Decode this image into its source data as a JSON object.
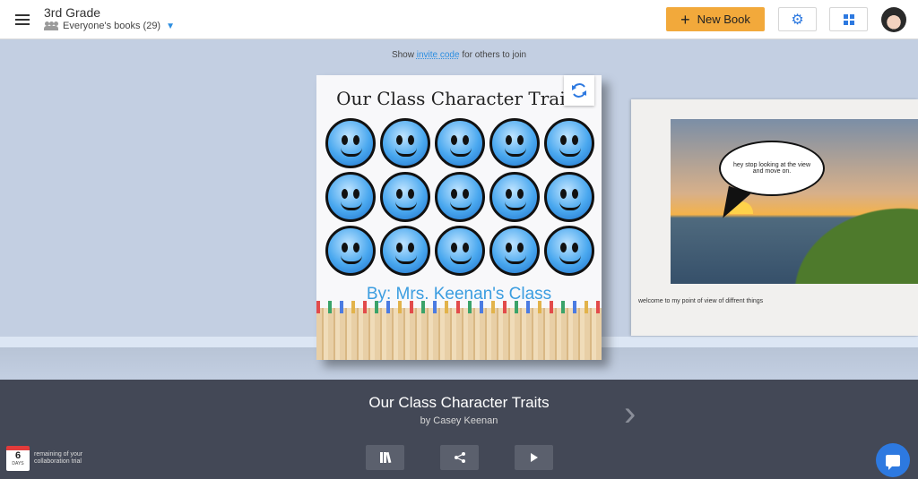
{
  "header": {
    "class_name": "3rd Grade",
    "filter_label": "Everyone's books (29)",
    "new_book_label": "New Book",
    "plus_glyph": "+",
    "settings_glyph": "⚙"
  },
  "stage": {
    "invite_prefix": "Show",
    "invite_link": "invite code",
    "invite_suffix": "for others to join",
    "cover": {
      "title": "Our Class Character Traits",
      "byline": "By: Mrs. Keenan's Class"
    },
    "page2": {
      "bubble_text": "hey stop looking at the view and move on.",
      "caption": "welcome to my point of view of diffrent things"
    }
  },
  "footer": {
    "book_title": "Our Class Character Traits",
    "author": "by Casey Keenan",
    "next_glyph": "›",
    "share_glyph": "<",
    "trial_days": "6",
    "trial_days_label": "DAYS",
    "trial_text": "remaining of your collaboration trial"
  },
  "colors": {
    "accent": "#f2a93b",
    "brand_blue": "#2d79e0",
    "stage_bg": "#c3cfe2",
    "bottom_bar": "#434856"
  },
  "icons": [
    "menu-icon",
    "people-icon",
    "chevron-down-icon",
    "plus-icon",
    "gear-icon",
    "grid-icon",
    "rotate-icon",
    "chevron-right-icon",
    "library-icon",
    "share-icon",
    "play-icon",
    "calendar-icon",
    "chat-icon"
  ]
}
